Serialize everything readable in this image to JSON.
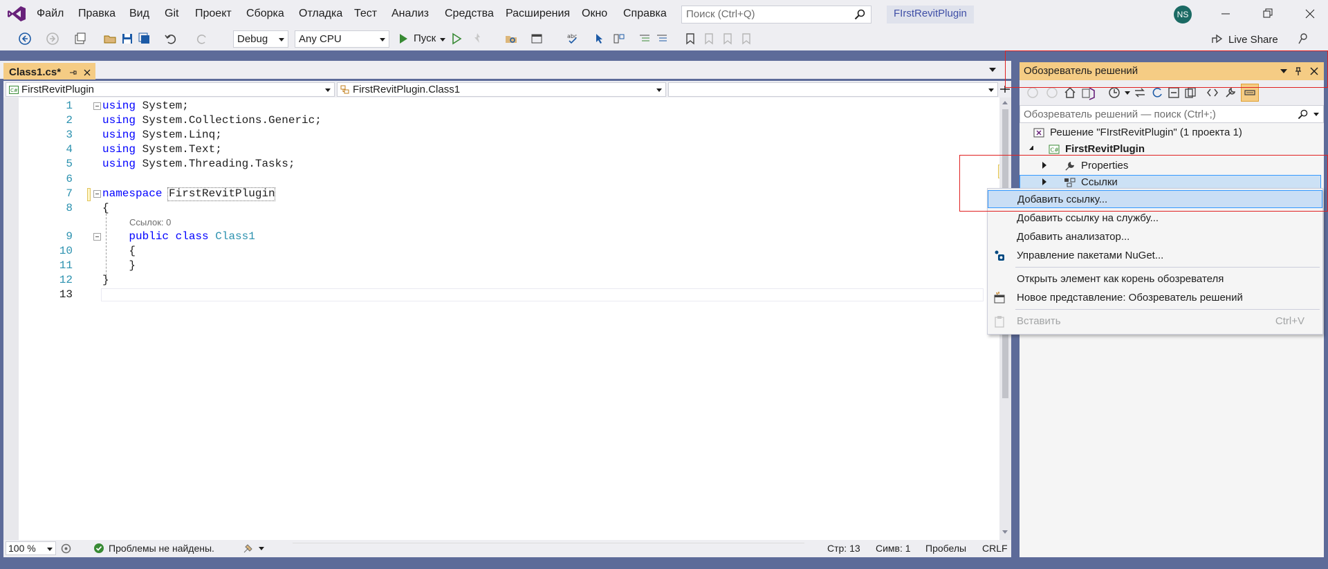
{
  "menu": {
    "items": [
      "Файл",
      "Правка",
      "Вид",
      "Git",
      "Проект",
      "Сборка",
      "Отладка",
      "Тест",
      "Анализ",
      "Средства",
      "Расширения",
      "Окно",
      "Справка"
    ],
    "search_placeholder": "Поиск (Ctrl+Q)",
    "project_name": "FIrstRevitPlugin",
    "avatar_initials": "NS"
  },
  "toolbar": {
    "config": "Debug",
    "platform": "Any CPU",
    "run_label": "Пуск",
    "live_share": "Live Share"
  },
  "editor": {
    "tab_title": "Class1.cs*",
    "nav_project": "FirstRevitPlugin",
    "nav_class": "FirstRevitPlugin.Class1",
    "nav_member": "",
    "lines": [
      {
        "n": "1",
        "tokens": [
          {
            "t": "using",
            "c": "kw"
          },
          {
            "t": " System;",
            "c": ""
          }
        ]
      },
      {
        "n": "2",
        "tokens": [
          {
            "t": "using",
            "c": "kw"
          },
          {
            "t": " System.Collections.Generic;",
            "c": ""
          }
        ]
      },
      {
        "n": "3",
        "tokens": [
          {
            "t": "using",
            "c": "kw"
          },
          {
            "t": " System.Linq;",
            "c": ""
          }
        ]
      },
      {
        "n": "4",
        "tokens": [
          {
            "t": "using",
            "c": "kw"
          },
          {
            "t": " System.Text;",
            "c": ""
          }
        ]
      },
      {
        "n": "5",
        "tokens": [
          {
            "t": "using",
            "c": "kw"
          },
          {
            "t": " System.Threading.Tasks;",
            "c": ""
          }
        ]
      },
      {
        "n": "6",
        "tokens": []
      },
      {
        "n": "7",
        "tokens": [
          {
            "t": "namespace",
            "c": "kw"
          },
          {
            "t": " FirstRevitPlugin",
            "c": ""
          }
        ]
      },
      {
        "n": "8",
        "tokens": [
          {
            "t": "{",
            "c": ""
          }
        ]
      },
      {
        "n": "9",
        "tokens": [
          {
            "t": "    public class ",
            "c": "kw"
          },
          {
            "t": "Class1",
            "c": "ty"
          }
        ]
      },
      {
        "n": "10",
        "tokens": [
          {
            "t": "    {",
            "c": ""
          }
        ]
      },
      {
        "n": "11",
        "tokens": [
          {
            "t": "    }",
            "c": ""
          }
        ]
      },
      {
        "n": "12",
        "tokens": [
          {
            "t": "}",
            "c": ""
          }
        ]
      },
      {
        "n": "13",
        "tokens": []
      }
    ],
    "codelens": "Ссылок: 0",
    "zoom": "100 %",
    "status_ok": "Проблемы не найдены.",
    "pos_line": "Стр: 13",
    "pos_col": "Симв: 1",
    "whitespace": "Пробелы",
    "eol": "CRLF"
  },
  "solution_explorer": {
    "title": "Обозреватель решений",
    "search_placeholder": "Обозреватель решений — поиск (Ctrl+;)",
    "solution": "Решение \"FIrstRevitPlugin\"  (1 проекта 1)",
    "project": "FirstRevitPlugin",
    "properties": "Properties",
    "references": "Ссылки"
  },
  "context_menu": {
    "items": [
      {
        "label": "Добавить ссылку...",
        "shortcut": "",
        "selected": true,
        "disabled": false,
        "icon": ""
      },
      {
        "label": "Добавить ссылку на службу...",
        "shortcut": "",
        "selected": false,
        "disabled": false,
        "icon": ""
      },
      {
        "label": "Добавить анализатор...",
        "shortcut": "",
        "selected": false,
        "disabled": false,
        "icon": ""
      },
      {
        "label": "Управление пакетами NuGet...",
        "shortcut": "",
        "selected": false,
        "disabled": false,
        "icon": "nuget-icon"
      },
      {
        "label": "Открыть элемент как корень обозревателя",
        "shortcut": "",
        "selected": false,
        "disabled": false,
        "icon": ""
      },
      {
        "label": "Новое представление: Обозреватель решений",
        "shortcut": "",
        "selected": false,
        "disabled": false,
        "icon": "new-view-icon"
      },
      {
        "label": "Вставить",
        "shortcut": "Ctrl+V",
        "selected": false,
        "disabled": true,
        "icon": "paste-icon"
      }
    ]
  },
  "colors": {
    "accent": "#68217a",
    "tab_active": "#f5cc84",
    "frame": "#5d6b99",
    "keyword": "#0000ff",
    "type": "#2b91af"
  }
}
